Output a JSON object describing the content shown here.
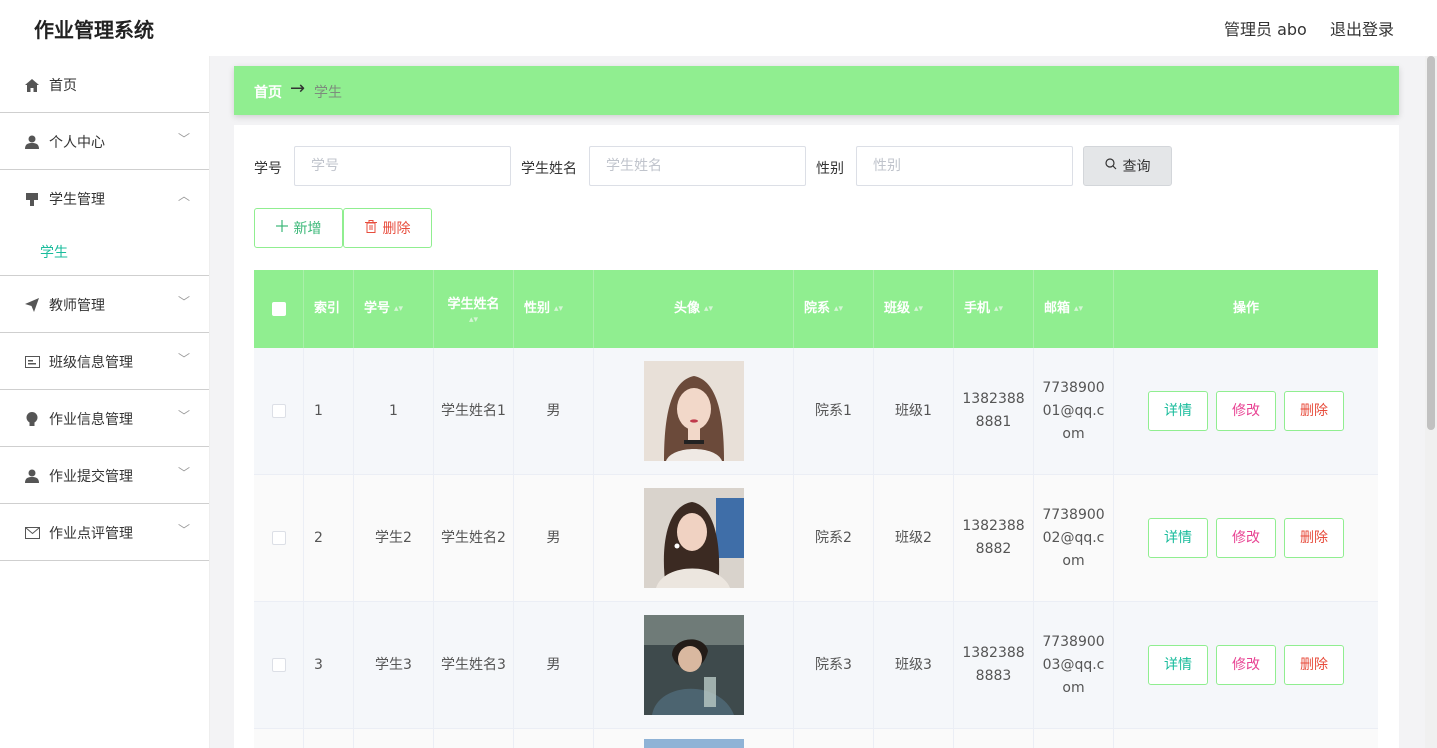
{
  "header": {
    "title": "作业管理系统",
    "user": "管理员 abo",
    "logout": "退出登录"
  },
  "sidebar": {
    "items": [
      {
        "label": "首页",
        "icon": "home-icon"
      },
      {
        "label": "个人中心",
        "icon": "user-icon"
      },
      {
        "label": "学生管理",
        "icon": "student-icon",
        "expanded": true,
        "subitems": [
          "学生"
        ]
      },
      {
        "label": "教师管理",
        "icon": "send-icon"
      },
      {
        "label": "班级信息管理",
        "icon": "card-icon"
      },
      {
        "label": "作业信息管理",
        "icon": "bulb-icon"
      },
      {
        "label": "作业提交管理",
        "icon": "user-icon"
      },
      {
        "label": "作业点评管理",
        "icon": "mail-icon"
      }
    ]
  },
  "breadcrumb": {
    "home": "首页",
    "separator": "→",
    "current": "学生"
  },
  "search": {
    "student_no_label": "学号",
    "student_no_placeholder": "学号",
    "student_name_label": "学生姓名",
    "student_name_placeholder": "学生姓名",
    "gender_label": "性别",
    "gender_placeholder": "性别",
    "query_label": "查询"
  },
  "actions": {
    "add_label": "新增",
    "delete_label": "删除"
  },
  "table": {
    "headers": [
      "索引",
      "学号",
      "学生姓名",
      "性别",
      "头像",
      "院系",
      "班级",
      "手机",
      "邮箱",
      "操作"
    ],
    "rows": [
      {
        "index": "1",
        "student_no": "1",
        "name": "学生姓名1",
        "gender": "男",
        "dept": "院系1",
        "class": "班级1",
        "phone": "13823888881",
        "email": "773890001@qq.com"
      },
      {
        "index": "2",
        "student_no": "学生2",
        "name": "学生姓名2",
        "gender": "男",
        "dept": "院系2",
        "class": "班级2",
        "phone": "13823888882",
        "email": "773890002@qq.com"
      },
      {
        "index": "3",
        "student_no": "学生3",
        "name": "学生姓名3",
        "gender": "男",
        "dept": "院系3",
        "class": "班级3",
        "phone": "13823888883",
        "email": "773890003@qq.com"
      }
    ],
    "op_labels": {
      "detail": "详情",
      "edit": "修改",
      "delete": "删除"
    }
  },
  "colors": {
    "accent": "#90ee90",
    "active": "#1abc9c",
    "danger": "#e74c3c",
    "edit": "#e84393"
  }
}
